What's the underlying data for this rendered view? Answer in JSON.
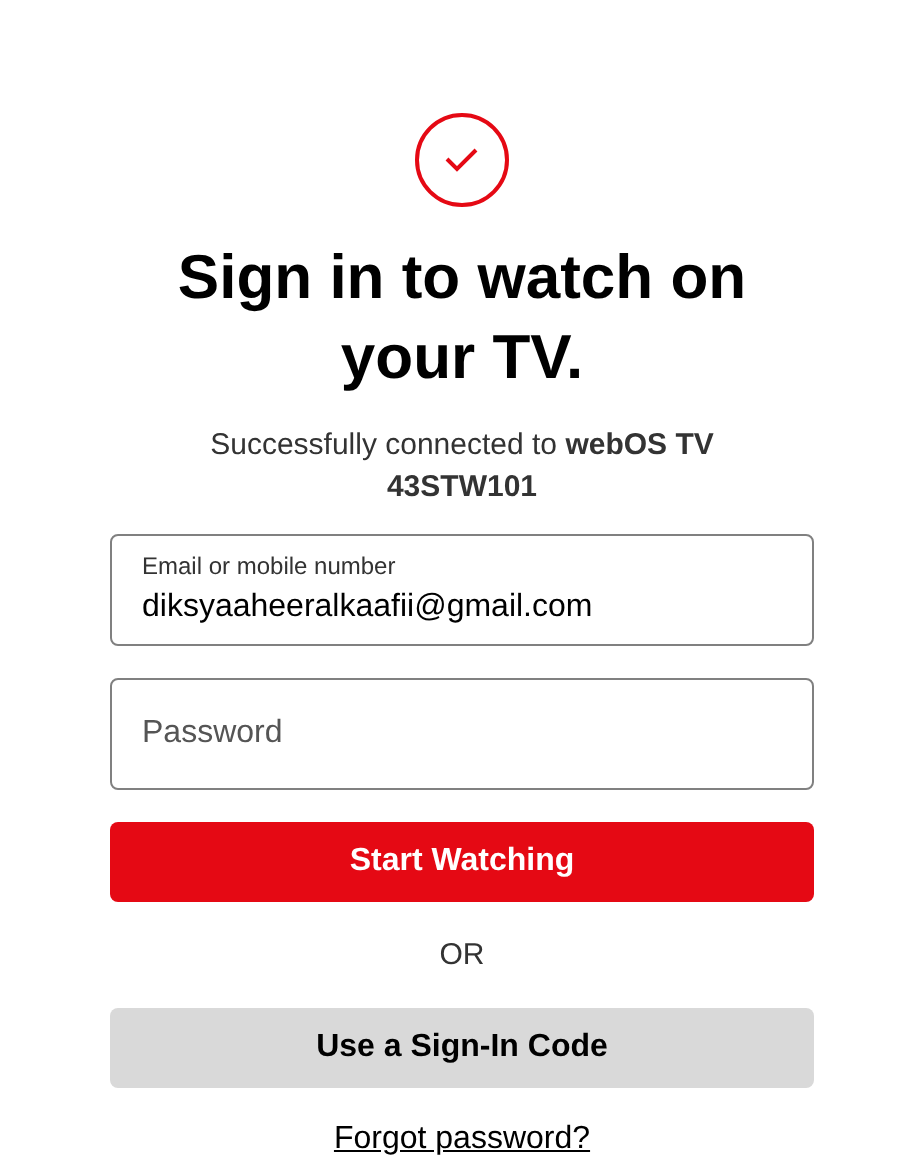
{
  "title": "Sign in to watch on your TV.",
  "subtitle": "Successfully connected to **webOS TV 43STW101**",
  "email_field": {
    "label": "Email or mobile number",
    "value": "diksyaaheeralkaafii@gmail.com"
  },
  "password_field": {
    "placeholder": "Password"
  },
  "primary_button": "Start Watching",
  "separator": "OR",
  "secondary_button": "Use a Sign-In Code",
  "link": "Forgot password?"
}
